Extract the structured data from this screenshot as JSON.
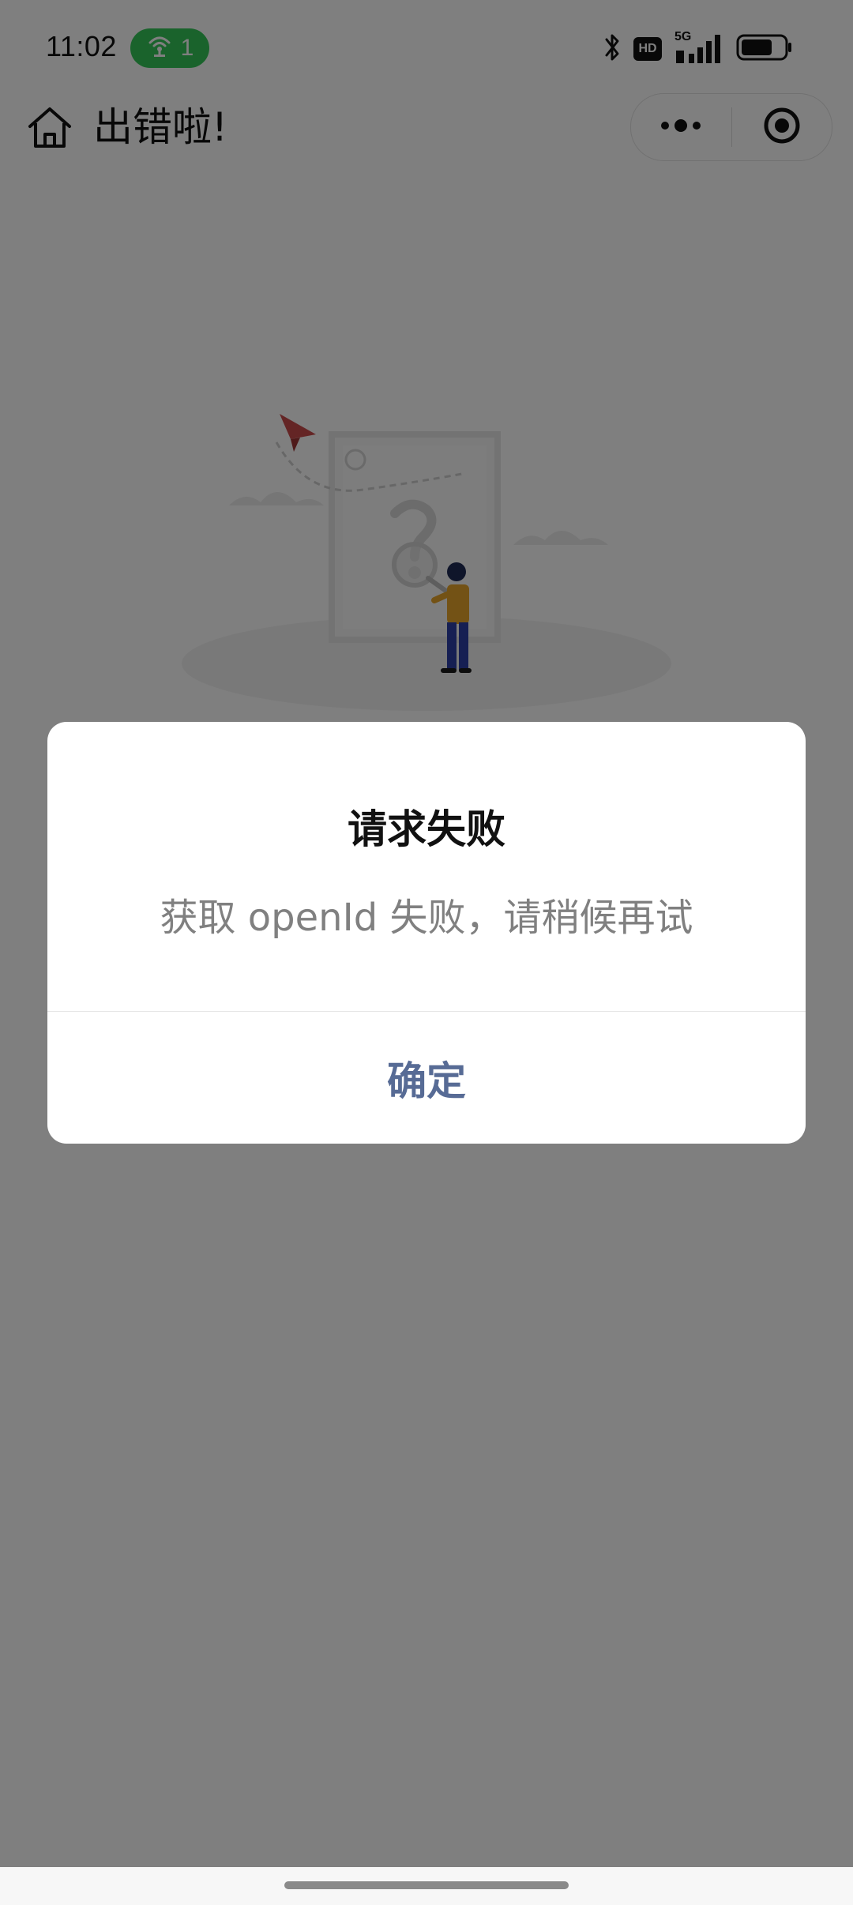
{
  "status_bar": {
    "time": "11:02",
    "hotspot_count": "1",
    "hd_label": "HD",
    "network_label": "5G",
    "hotspot_color": "#35c759"
  },
  "nav": {
    "title": "出错啦!",
    "home_icon": "home-icon",
    "more_icon": "more-dots-icon",
    "close_icon": "target-circle-icon"
  },
  "modal": {
    "title": "请求失败",
    "content": "获取 openId 失败，请稍候再试",
    "confirm_label": "确定",
    "confirm_color": "#576b95"
  },
  "colors": {
    "mask": "rgba(0,0,0,0.5)",
    "dialog_bg": "#ffffff"
  }
}
